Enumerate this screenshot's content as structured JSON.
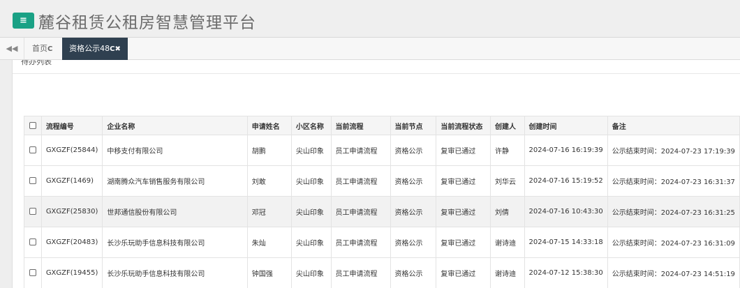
{
  "header": {
    "menu_icon": "menu-icon",
    "menu_glyph": "≡",
    "title": "麓谷租赁公租房智慧管理平台"
  },
  "tabbar": {
    "back_glyph": "◀◀",
    "home_label": "首页",
    "refresh_glyph": "C",
    "active_label": "资格公示48",
    "close_glyph": "✖"
  },
  "content": {
    "section_title": "待办列表"
  },
  "table": {
    "headers": [
      "",
      "流程编号",
      "企业名称",
      "申请姓名",
      "小区名称",
      "当前流程",
      "当前节点",
      "当前流程状态",
      "创建人",
      "创建时间",
      "备注"
    ],
    "rows": [
      [
        "GXGZF(25844)",
        "中移支付有限公司",
        "胡鹏",
        "尖山印象",
        "员工申请流程",
        "资格公示",
        "复审已通过",
        "许静",
        "2024-07-16 16:19:39",
        "公示结束时间：2024-07-23 17:19:39"
      ],
      [
        "GXGZF(1469)",
        "湖南腾众汽车销售服务有限公司",
        "刘敢",
        "尖山印象",
        "员工申请流程",
        "资格公示",
        "复审已通过",
        "刘华云",
        "2024-07-16 15:19:52",
        "公示结束时间：2024-07-23 16:31:37"
      ],
      [
        "GXGZF(25830)",
        "世邦通信股份有限公司",
        "邓冠",
        "尖山印象",
        "员工申请流程",
        "资格公示",
        "复审已通过",
        "刘倩",
        "2024-07-16 10:43:30",
        "公示结束时间：2024-07-23 16:31:25"
      ],
      [
        "GXGZF(20483)",
        "长沙乐玩助手信息科技有限公司",
        "朱灿",
        "尖山印象",
        "员工申请流程",
        "资格公示",
        "复审已通过",
        "谢诗迪",
        "2024-07-15 14:33:18",
        "公示结束时间：2024-07-23 16:31:09"
      ],
      [
        "GXGZF(19455)",
        "长沙乐玩助手信息科技有限公司",
        "钟国强",
        "尖山印象",
        "员工申请流程",
        "资格公示",
        "复审已通过",
        "谢诗迪",
        "2024-07-12 15:38:30",
        "公示结束时间：2024-07-23 14:51:19"
      ]
    ]
  },
  "colors": {
    "menu_button": "#1aa185",
    "active_tab": "#2f4050"
  }
}
